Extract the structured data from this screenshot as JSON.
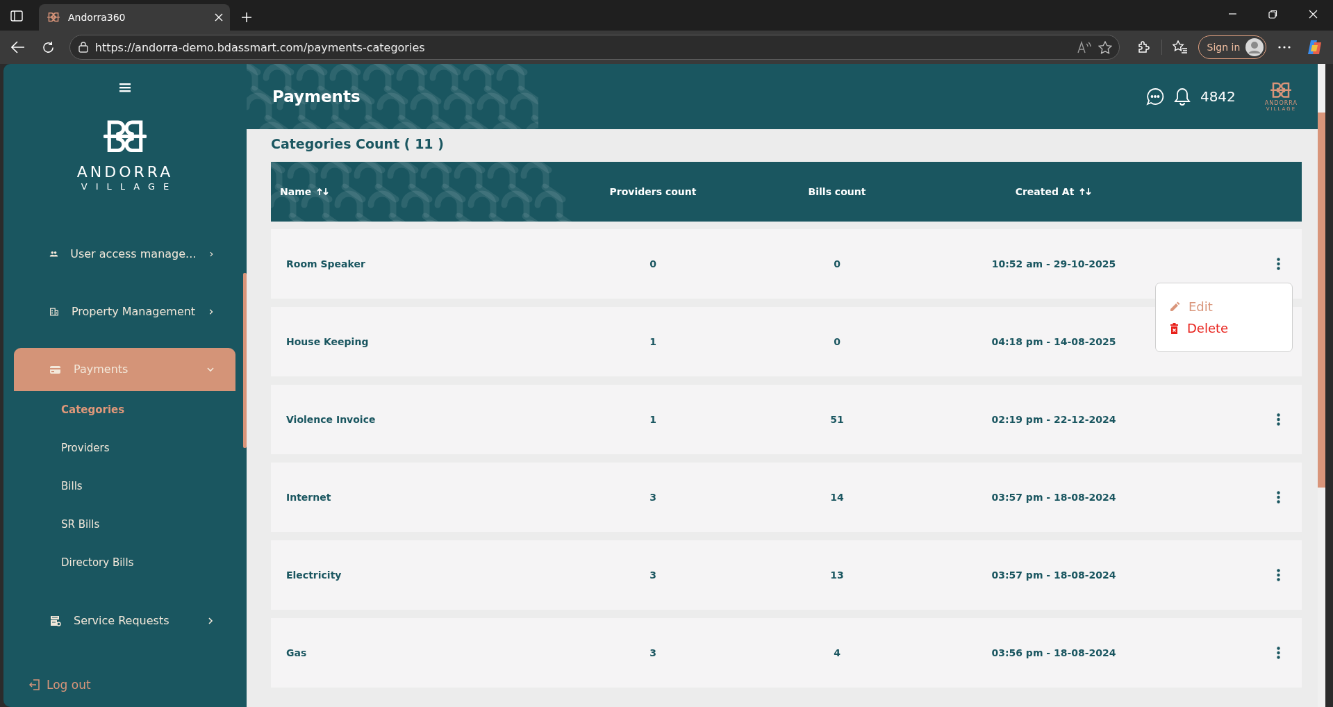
{
  "browser": {
    "tab_title": "Andorra360",
    "url": "https://andorra-demo.bdassmart.com/payments-categories",
    "sign_in": "Sign in"
  },
  "sidebar": {
    "brand": {
      "name": "ANDORRA",
      "tagline": "VILLAGE"
    },
    "items": [
      {
        "label": "User access manage...",
        "selected": false,
        "expanded": false
      },
      {
        "label": "Property Management",
        "selected": false,
        "expanded": false
      },
      {
        "label": "Payments",
        "selected": true,
        "expanded": true,
        "children": [
          {
            "label": "Categories",
            "selected": true
          },
          {
            "label": "Providers",
            "selected": false
          },
          {
            "label": "Bills",
            "selected": false
          },
          {
            "label": "SR Bills",
            "selected": false
          },
          {
            "label": "Directory Bills",
            "selected": false
          }
        ]
      },
      {
        "label": "Service Requests",
        "selected": false,
        "expanded": false
      }
    ],
    "logout": "Log out"
  },
  "header": {
    "title": "Payments",
    "notification_count": "4842",
    "brand": {
      "name": "ANDORRA",
      "tagline": "VILLAGE"
    }
  },
  "table": {
    "count_title": "Categories Count ( 11 )",
    "columns": [
      {
        "label": "Name",
        "sortable": true
      },
      {
        "label": "Providers count",
        "sortable": false
      },
      {
        "label": "Bills count",
        "sortable": false
      },
      {
        "label": "Created At",
        "sortable": true
      }
    ],
    "rows": [
      {
        "name": "Room Speaker",
        "providers": "0",
        "bills": "0",
        "created_at": "10:52 am - 29-10-2025",
        "menu_open": true
      },
      {
        "name": "House Keeping",
        "providers": "1",
        "bills": "0",
        "created_at": "04:18 pm - 14-08-2025",
        "menu_open": false
      },
      {
        "name": "Violence Invoice",
        "providers": "1",
        "bills": "51",
        "created_at": "02:19 pm - 22-12-2024",
        "menu_open": false
      },
      {
        "name": "Internet",
        "providers": "3",
        "bills": "14",
        "created_at": "03:57 pm - 18-08-2024",
        "menu_open": false
      },
      {
        "name": "Electricity",
        "providers": "3",
        "bills": "13",
        "created_at": "03:57 pm - 18-08-2024",
        "menu_open": false
      },
      {
        "name": "Gas",
        "providers": "3",
        "bills": "4",
        "created_at": "03:56 pm - 18-08-2024",
        "menu_open": false
      }
    ],
    "row_menu": [
      {
        "label": "Edit",
        "kind": "edit"
      },
      {
        "label": "Delete",
        "kind": "delete"
      }
    ]
  }
}
